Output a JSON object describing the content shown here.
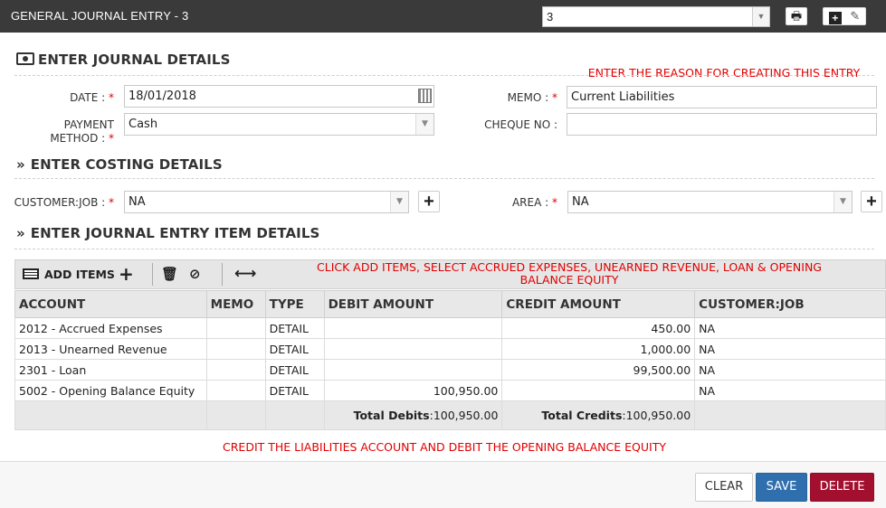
{
  "window": {
    "title": "GENERAL JOURNAL ENTRY - 3",
    "entry_select_value": "3"
  },
  "journal_details": {
    "heading": "ENTER JOURNAL DETAILS",
    "note": "ENTER THE REASON FOR CREATING THIS ENTRY",
    "date_label": "DATE :",
    "date_value": "18/01/2018",
    "payment_label_1": "PAYMENT",
    "payment_label_2": "METHOD :",
    "payment_value": "Cash",
    "memo_label": "MEMO :",
    "memo_value": "Current Liabilities",
    "cheque_label": "CHEQUE NO :",
    "cheque_value": "",
    "required_mark": "*"
  },
  "costing_details": {
    "heading": "ENTER COSTING DETAILS",
    "customer_label": "CUSTOMER:JOB :",
    "customer_value": "NA",
    "area_label": "AREA :",
    "area_value": "NA"
  },
  "item_details": {
    "heading": "ENTER JOURNAL ENTRY ITEM DETAILS",
    "add_items_label": "ADD ITEMS",
    "note_line1": "CLICK ADD ITEMS, SELECT ACCRUED EXPENSES, UNEARNED REVENUE, LOAN & OPENING",
    "note_line2": "BALANCE EQUITY",
    "columns": [
      "ACCOUNT",
      "MEMO",
      "TYPE",
      "DEBIT AMOUNT",
      "CREDIT AMOUNT",
      "CUSTOMER:JOB"
    ],
    "rows": [
      {
        "account": "2012 - Accrued Expenses",
        "memo": "",
        "type": "DETAIL",
        "debit": "",
        "credit": "450.00",
        "customer": "NA"
      },
      {
        "account": "2013 - Unearned Revenue",
        "memo": "",
        "type": "DETAIL",
        "debit": "",
        "credit": "1,000.00",
        "customer": "NA"
      },
      {
        "account": "2301 - Loan",
        "memo": "",
        "type": "DETAIL",
        "debit": "",
        "credit": "99,500.00",
        "customer": "NA"
      },
      {
        "account": "5002 - Opening Balance Equity",
        "memo": "",
        "type": "DETAIL",
        "debit": "100,950.00",
        "credit": "",
        "customer": "NA"
      }
    ],
    "total_debits_label": "Total Debits",
    "total_debits_value": ":100,950.00",
    "total_credits_label": "Total Credits",
    "total_credits_value": ":100,950.00",
    "bottom_note": "CREDIT THE LIABILITIES ACCOUNT AND DEBIT THE OPENING BALANCE EQUITY"
  },
  "footer": {
    "clear_label": "CLEAR",
    "save_label": "SAVE",
    "delete_label": "DELETE"
  },
  "colors": {
    "titlebar": "#3a3a3a",
    "note_red": "#e00000",
    "save_blue": "#2f6fad",
    "delete_red": "#a3102f"
  },
  "icons": [
    "print-icon",
    "plus-square-icon",
    "edit-icon",
    "money-icon",
    "chevron-double-right-icon",
    "calendar-icon",
    "list-icon",
    "plus-icon",
    "trash-icon",
    "ban-icon",
    "resize-horizontal-icon"
  ]
}
